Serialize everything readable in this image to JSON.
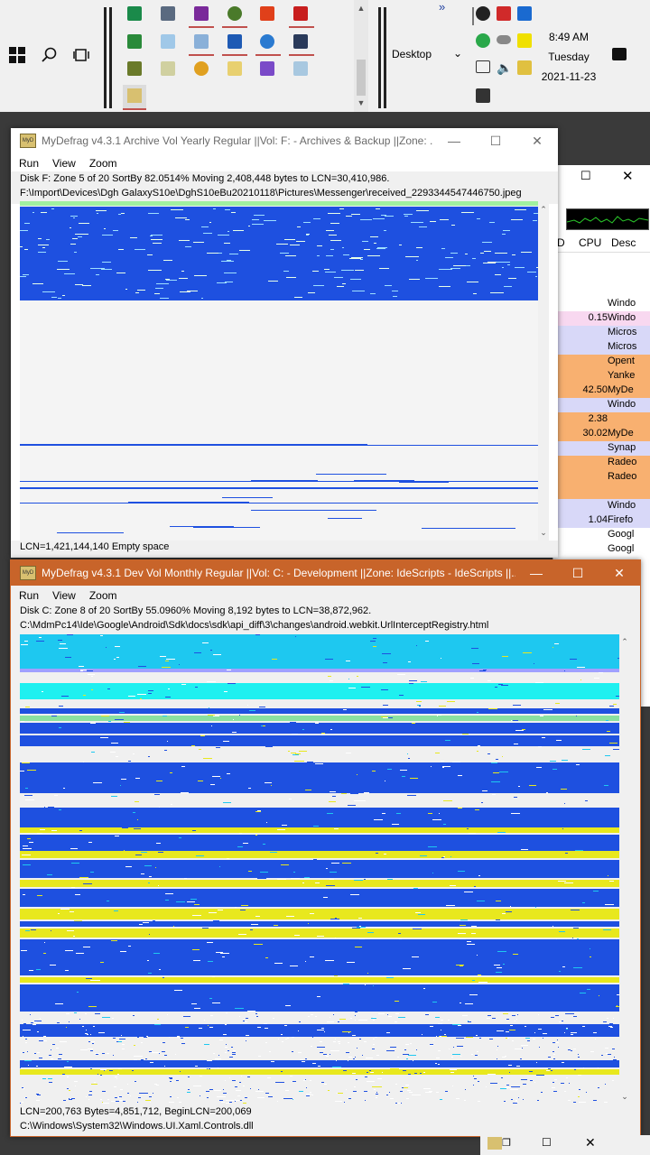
{
  "taskbar": {
    "desktop_label": "Desktop",
    "time": "8:49 AM",
    "day": "Tuesday",
    "date": "2021-11-23",
    "overflow": "»"
  },
  "taskmgr": {
    "cpu_header": "CPU",
    "desc_header": "Desc",
    "col_prefix": "D",
    "rows": [
      {
        "cpu": "",
        "desc": "Windo"
      },
      {
        "cpu": "0.15",
        "desc": "Windo"
      },
      {
        "cpu": "",
        "desc": "Micros"
      },
      {
        "cpu": "",
        "desc": "Micros"
      },
      {
        "cpu": "",
        "desc": "Opent"
      },
      {
        "cpu": "",
        "desc": "Yanke"
      },
      {
        "cpu": "42.50",
        "desc": "MyDe"
      },
      {
        "cpu": "",
        "desc": "Windo"
      },
      {
        "cpu": "2.38",
        "desc": ""
      },
      {
        "cpu": "30.02",
        "desc": "MyDe"
      },
      {
        "cpu": "",
        "desc": "Synap"
      },
      {
        "cpu": "",
        "desc": "Radeo"
      },
      {
        "cpu": "",
        "desc": "Radeo"
      },
      {
        "cpu": "",
        "desc": ""
      },
      {
        "cpu": "",
        "desc": "Windo"
      },
      {
        "cpu": "1.04",
        "desc": "Firefo"
      },
      {
        "cpu": "",
        "desc": "Googl"
      },
      {
        "cpu": "",
        "desc": "Googl"
      }
    ]
  },
  "win1": {
    "title": "MyDefrag v4.3.1   Archive Vol Yearly Regular ||Vol: F: - Archives & Backup ||Zone: ...",
    "menu": [
      "Run",
      "View",
      "Zoom"
    ],
    "status1": "Disk F:   Zone 5 of 20   SortBy   82.0514%   Moving 2,408,448 bytes to LCN=30,410,986.",
    "status2": "F:\\Import\\Devices\\Dgh GalaxyS10e\\DghS10eBu20210118\\Pictures\\Messenger\\received_2293344547446750.jpeg",
    "bottom": "LCN=1,421,144,140    Empty space"
  },
  "win2": {
    "title": "MyDefrag v4.3.1   Dev Vol Monthly Regular ||Vol: C: - Development ||Zone: IdeScripts - IdeScripts ||...",
    "menu": [
      "Run",
      "View",
      "Zoom"
    ],
    "status1": "Disk C:   Zone 8 of 20   SortBy   55.0960%   Moving 8,192 bytes to LCN=38,872,962.",
    "status2": "C:\\MdmPc14\\Ide\\Google\\Android\\Sdk\\docs\\sdk\\api_diff\\3\\changes\\android.webkit.UrlInterceptRegistry.html",
    "bottom1": "LCN=200,763    Bytes=4,851,712, BeginLCN=200,069",
    "bottom2": "C:\\Windows\\System32\\Windows.UI.Xaml.Controls.dll"
  },
  "colors": {
    "used": "#1e50e0",
    "free": "#f0f0f0",
    "cyan": "#1ec8f0",
    "yellow": "#e8e81e",
    "title_active": "#c8642a",
    "taskmgr_orange": "#f8b070",
    "taskmgr_lavender": "#d8d8f8"
  }
}
